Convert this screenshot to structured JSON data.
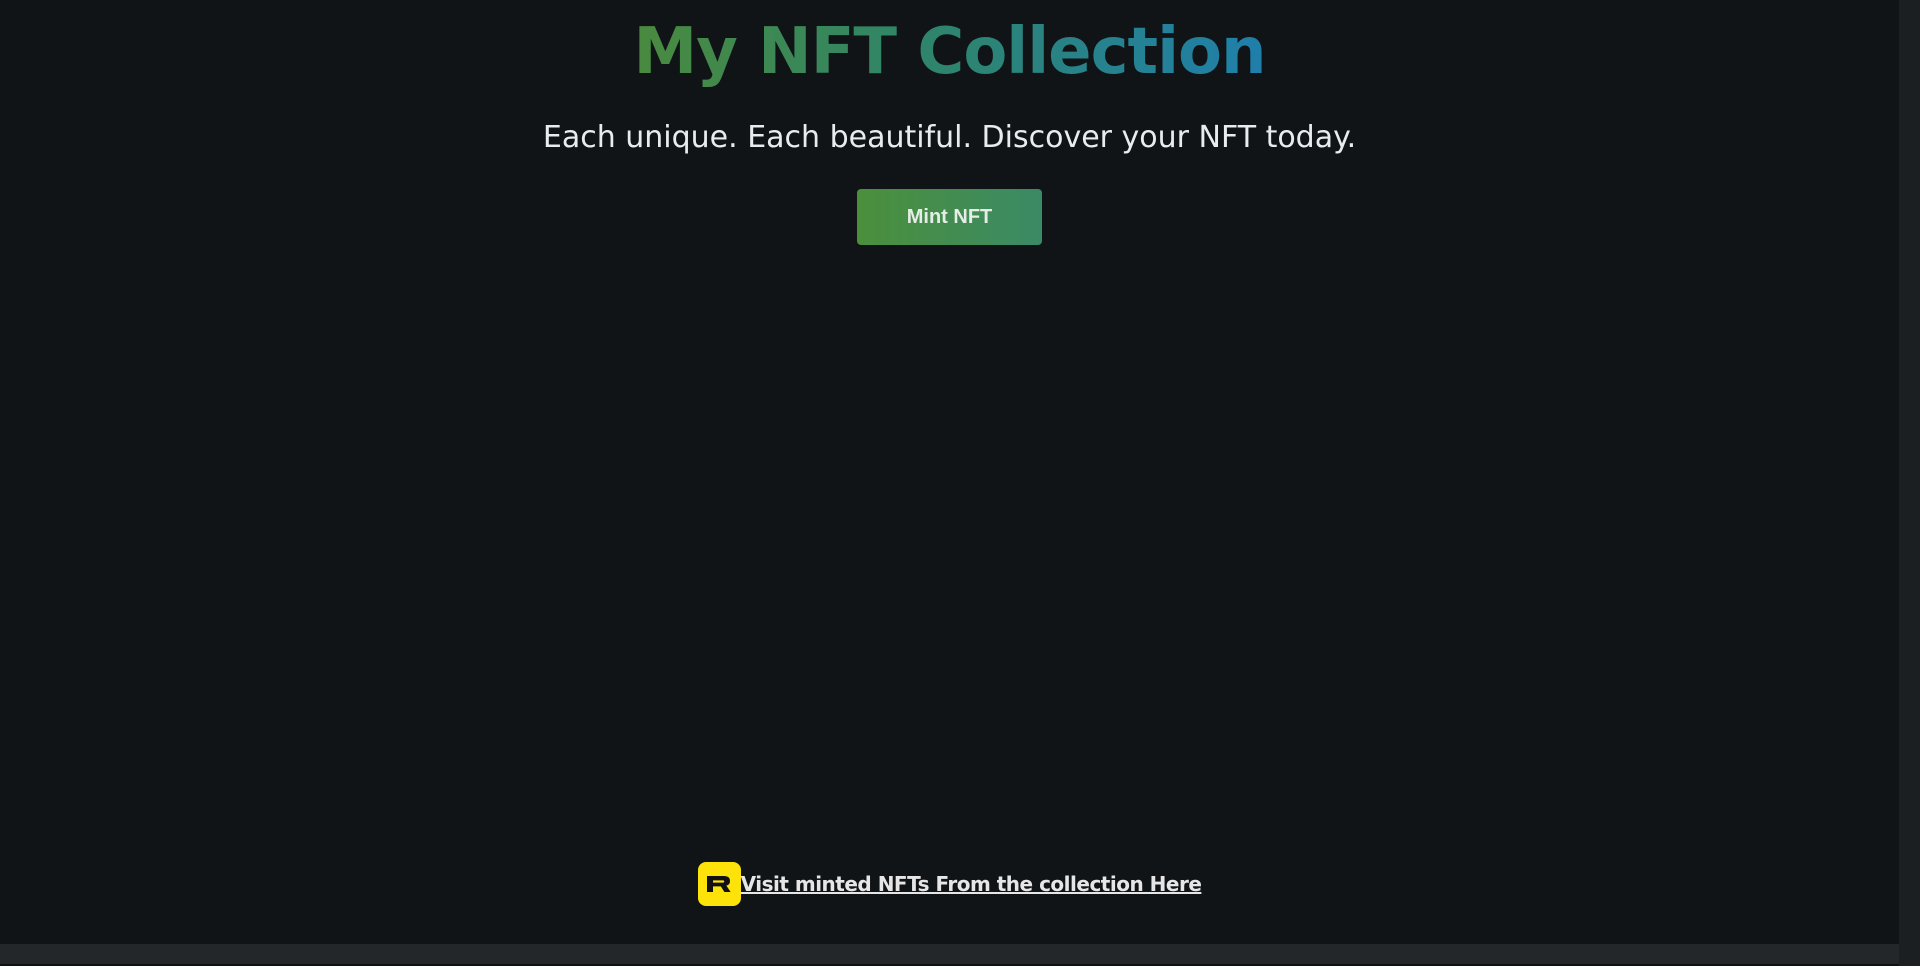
{
  "hero": {
    "title": "My NFT Collection",
    "subtitle": "Each unique. Each beautiful. Discover your NFT today.",
    "mint_button_label": "Mint NFT"
  },
  "footer": {
    "link_text": "Visit minted NFTs From the collection Here",
    "logo_icon": "rarible-logo-icon",
    "logo_color": "#fee30a"
  },
  "colors": {
    "background": "#111417",
    "title_gradient_start": "#4a8a3f",
    "title_gradient_end": "#1f7fac",
    "button_gradient_start": "#4b8f3b",
    "button_gradient_end": "#3b8a66",
    "text": "#e9ecef"
  }
}
